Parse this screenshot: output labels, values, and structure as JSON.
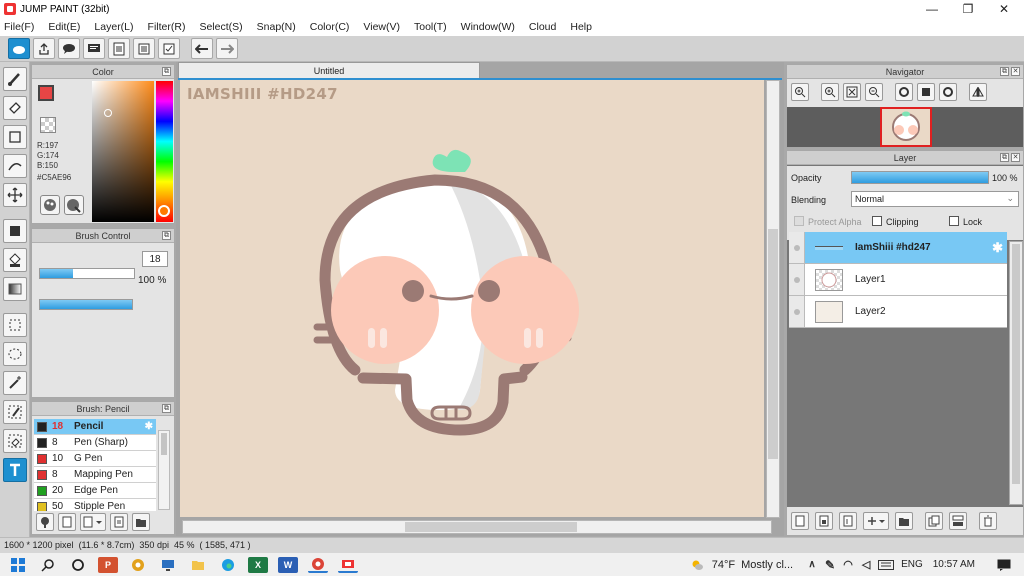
{
  "app": {
    "title": "JUMP PAINT (32bit)",
    "window_controls": {
      "minimize": "—",
      "restore": "❐",
      "close": "✕"
    }
  },
  "menu": [
    "File(F)",
    "Edit(E)",
    "Layer(L)",
    "Filter(R)",
    "Select(S)",
    "Snap(N)",
    "Color(C)",
    "View(V)",
    "Tool(T)",
    "Window(W)",
    "Cloud",
    "Help"
  ],
  "toolbar": {
    "icons": [
      "cloud-icon",
      "share-icon",
      "comment-icon",
      "message-icon",
      "document-icon",
      "list-icon",
      "checklist-icon",
      "undo-icon",
      "redo-icon"
    ]
  },
  "left_tools": [
    "brush-icon",
    "eraser-icon",
    "rectangle-icon",
    "curve-icon",
    "move-icon",
    "fill-rect-icon",
    "bucket-icon",
    "gradient-icon",
    "select-rect-icon",
    "lasso-icon",
    "magic-wand-icon",
    "select-pen-icon",
    "select-eraser-icon",
    "text-icon"
  ],
  "color_panel": {
    "title": "Color",
    "r_label": "R:197",
    "g_label": "G:174",
    "b_label": "B:150",
    "hex_label": "#C5AE96",
    "fg_color": "#e64545",
    "bg_color": "#70d070"
  },
  "brush_control": {
    "title": "Brush Control",
    "size_value": "18",
    "size_fraction": 0.35,
    "opacity_label": "100 %",
    "opacity_fraction": 1.0
  },
  "brush_list": {
    "title": "Brush: Pencil",
    "items": [
      {
        "size": "18",
        "name": "Pencil",
        "color": "#222222",
        "selected": true
      },
      {
        "size": "8",
        "name": "Pen (Sharp)",
        "color": "#222222"
      },
      {
        "size": "10",
        "name": "G Pen",
        "color": "#e03030"
      },
      {
        "size": "8",
        "name": "Mapping Pen",
        "color": "#e03030"
      },
      {
        "size": "20",
        "name": "Edge Pen",
        "color": "#20a020"
      },
      {
        "size": "50",
        "name": "Stipple Pen",
        "color": "#e0c020"
      }
    ]
  },
  "canvas": {
    "tab_title": "Untitled",
    "watermark": "IAMSHIII #HD247",
    "background": "#ead9c7"
  },
  "navigator": {
    "title": "Navigator"
  },
  "layer_panel": {
    "title": "Layer",
    "opacity_label": "Opacity",
    "opacity_value": "100 %",
    "opacity_fraction": 1.0,
    "blending_label": "Blending",
    "blending_value": "Normal",
    "protect_alpha": "Protect Alpha",
    "clipping": "Clipping",
    "lock": "Lock",
    "layers": [
      {
        "name": "IamShiii #hd247",
        "selected": true
      },
      {
        "name": "Layer1"
      },
      {
        "name": "Layer2"
      }
    ]
  },
  "status_bar": {
    "size": "1600 * 1200 pixel",
    "physical": "(11.6 * 8.7cm)",
    "dpi": "350 dpi",
    "zoom": "45 %",
    "coords": "( 1585, 471 )"
  },
  "taskbar": {
    "temperature": "74°F",
    "weather": "Mostly cl...",
    "language": "ENG",
    "time": "10:57 AM"
  }
}
